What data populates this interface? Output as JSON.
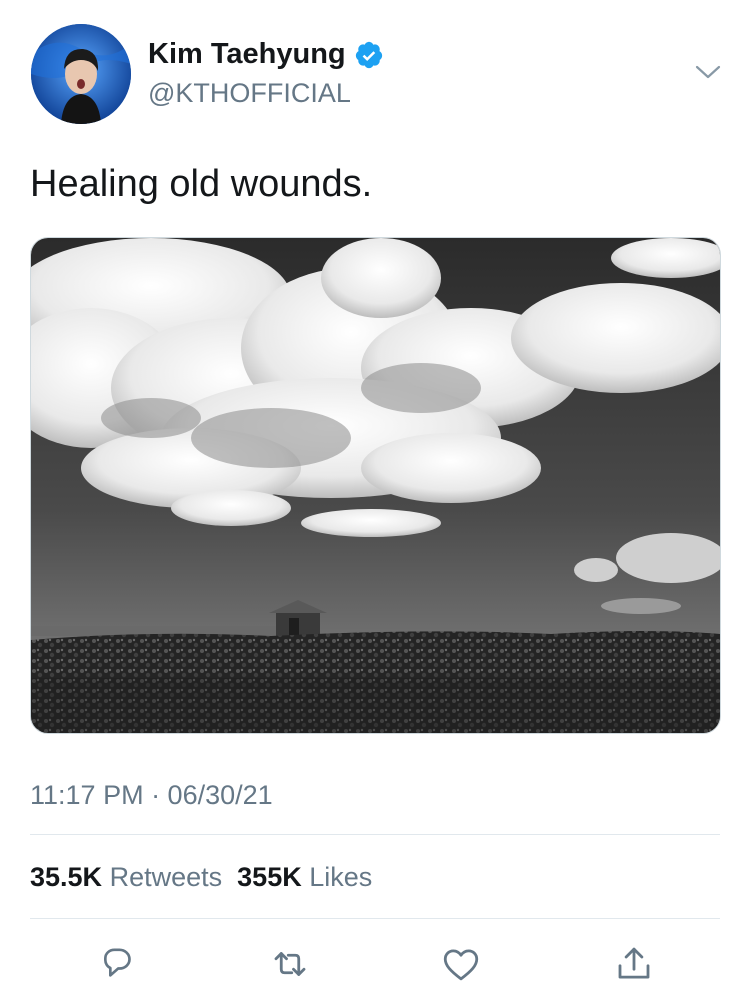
{
  "author": {
    "display_name": "Kim Taehyung",
    "handle": "@KTHOFFICIAL",
    "verified": true
  },
  "tweet": {
    "text": "Healing old wounds.",
    "media_icon": "black-and-white-landscape-photo",
    "timestamp": "11:17 PM · 06/30/21"
  },
  "stats": {
    "retweets_count": "35.5K",
    "retweets_label": "Retweets",
    "likes_count": "355K",
    "likes_label": "Likes"
  },
  "actions": {
    "reply_icon": "reply-icon",
    "retweet_icon": "retweet-icon",
    "like_icon": "heart-icon",
    "share_icon": "share-icon"
  },
  "colors": {
    "verified_blue": "#1da1f2",
    "text_primary": "#14171a",
    "text_secondary": "#657786",
    "divider": "#e1e8ed"
  }
}
